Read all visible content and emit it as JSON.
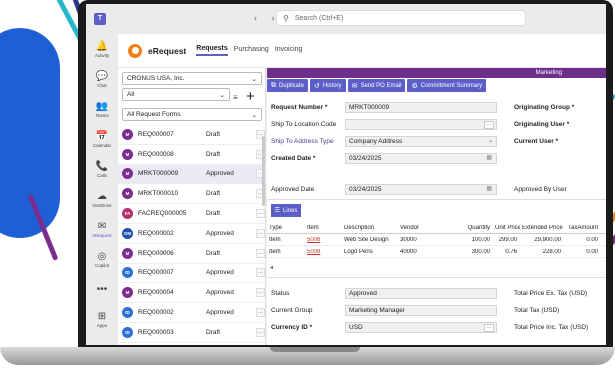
{
  "window": {
    "search_placeholder": "Search (Ctrl+E)",
    "nav_arrows": "‹ ›"
  },
  "rail": [
    {
      "icon": "🔔",
      "label": "Activity",
      "name": "activity"
    },
    {
      "icon": "💬",
      "label": "Chat",
      "name": "chat"
    },
    {
      "icon": "👥",
      "label": "Teams",
      "name": "teams"
    },
    {
      "icon": "📅",
      "label": "Calendar",
      "name": "calendar"
    },
    {
      "icon": "📞",
      "label": "Calls",
      "name": "calls"
    },
    {
      "icon": "☁",
      "label": "OneDrive",
      "name": "onedrive"
    },
    {
      "icon": "✉",
      "label": "eRequest",
      "name": "erequest"
    },
    {
      "icon": "◎",
      "label": "Copilot",
      "name": "copilot"
    },
    {
      "icon": "•••",
      "label": "",
      "name": "more"
    },
    {
      "icon": "⊞",
      "label": "Apps",
      "name": "apps"
    }
  ],
  "app": {
    "name": "eRequest",
    "tabs": [
      "Requests",
      "Purchasing",
      "Invoicing"
    ],
    "active_tab": 0
  },
  "listpane": {
    "company": "CRONUS USA, Inc.",
    "filter": "All",
    "form_filter": "All Request Forms",
    "items": [
      {
        "id": "REQ000007",
        "status": "Draft",
        "initials": "M",
        "color": "#7b2d8e"
      },
      {
        "id": "REQ000008",
        "status": "Draft",
        "initials": "M",
        "color": "#7b2d8e"
      },
      {
        "id": "MRKT000009",
        "status": "Approved",
        "initials": "M",
        "color": "#7b2d8e"
      },
      {
        "id": "MRKT000010",
        "status": "Draft",
        "initials": "M",
        "color": "#7b2d8e"
      },
      {
        "id": "FACREQ000005",
        "status": "Draft",
        "initials": "FA",
        "color": "#b0306a"
      },
      {
        "id": "REQ000002",
        "status": "Approved",
        "initials": "OM",
        "color": "#1f4fb0"
      },
      {
        "id": "REQ000006",
        "status": "Draft",
        "initials": "M",
        "color": "#7b2d8e"
      },
      {
        "id": "REQ000007",
        "status": "Approved",
        "initials": "ID",
        "color": "#2d6fd6"
      },
      {
        "id": "REQ000004",
        "status": "Approved",
        "initials": "M",
        "color": "#7b2d8e"
      },
      {
        "id": "REQ000002",
        "status": "Approved",
        "initials": "ID",
        "color": "#2d6fd6"
      },
      {
        "id": "REQ000003",
        "status": "Draft",
        "initials": "ID",
        "color": "#2d6fd6"
      }
    ]
  },
  "form": {
    "banner": "Marketing",
    "toolbar": [
      "Duplicate",
      "History",
      "Send PO Email",
      "Commitment Summary"
    ],
    "request_number_label": "Request Number *",
    "request_number": "MRKT000009",
    "ship_to_location_label": "Ship To Location Code",
    "ship_to_location": "",
    "ship_to_address_type_label": "Ship To Address Type",
    "ship_to_address_type": "Company Address",
    "created_date_label": "Created Date *",
    "created_date": "03/24/2025",
    "originating_group_label": "Originating Group *",
    "originating_user_label": "Originating User *",
    "current_user_label": "Current User *",
    "approved_date_label": "Approved Date",
    "approved_date": "03/24/2025",
    "approved_by_label": "Approved By User",
    "lines_button": "Lines",
    "status_label": "Status",
    "status": "Approved",
    "current_group_label": "Current Group",
    "current_group": "Marketing Manager",
    "currency_label": "Currency ID *",
    "currency": "USD",
    "total_ex_tax_label": "Total Price Ex. Tax (USD)",
    "total_tax_label": "Total Tax (USD)",
    "total_inc_tax_label": "Total Price Inc. Tax (USD)"
  },
  "lines": {
    "columns": [
      "Type",
      "Item",
      "Description",
      "Vendor",
      "Quantity",
      "Unit Price",
      "Extended Price",
      "TaxAmount"
    ],
    "rows": [
      [
        "Item",
        "5006",
        "Web Site Design",
        "30000",
        "100.00",
        "299.00",
        "29,900.00",
        "0.00"
      ],
      [
        "Item",
        "5008",
        "Logo Pens",
        "40000",
        "300.00",
        "0.76",
        "228.00",
        "0.00"
      ]
    ]
  },
  "colors": {
    "accent": "#5b5fc7",
    "banner": "#6d2e8c",
    "app_logo": "#f07f18"
  }
}
